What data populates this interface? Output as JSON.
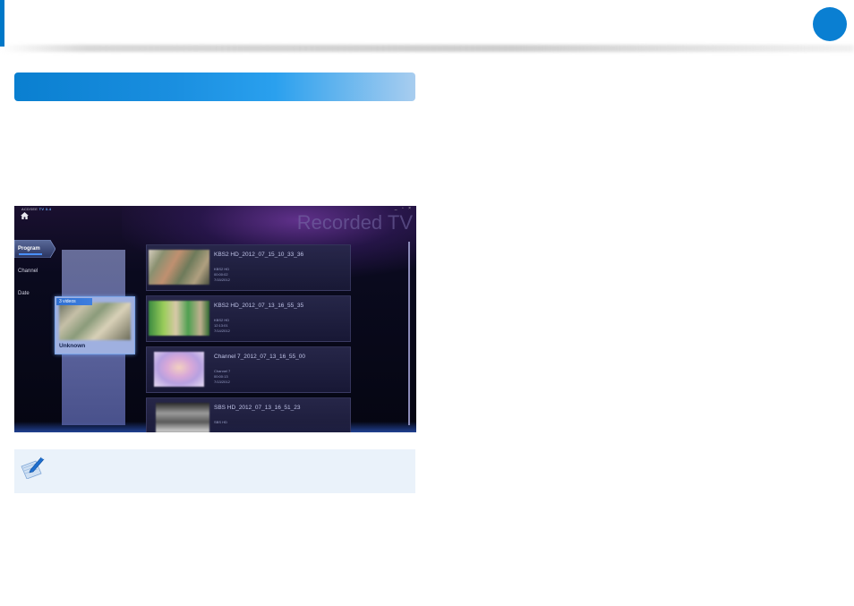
{
  "app": {
    "brand_prefix": "ACDSEE",
    "brand_name": "TV 3.4",
    "window_controls": "_ ▫ ×",
    "screen_title": "Recorded TV",
    "nav": [
      {
        "label": "Program"
      },
      {
        "label": "Channel"
      },
      {
        "label": "Date"
      }
    ],
    "group": {
      "count_label": "3 videos",
      "name": "Unknown"
    },
    "recordings": [
      {
        "title": "KBS2 HD_2012_07_15_10_33_36",
        "channel": "KBS2 HD",
        "duration": "00:00:02",
        "date": "7/15/2012"
      },
      {
        "title": "KBS2 HD_2012_07_13_16_55_35",
        "channel": "KBS2 HD",
        "duration": "12:13:01",
        "date": "7/14/2012"
      },
      {
        "title": "Channel 7_2012_07_13_16_55_00",
        "channel": "Channel 7",
        "duration": "00:00:13",
        "date": "7/13/2012"
      },
      {
        "title": "SBS HD_2012_07_13_16_51_23",
        "channel": "SBS HD",
        "duration": "",
        "date": ""
      }
    ]
  },
  "colors": {
    "accent": "#0078c8",
    "note_bg": "#eaf2fa"
  }
}
